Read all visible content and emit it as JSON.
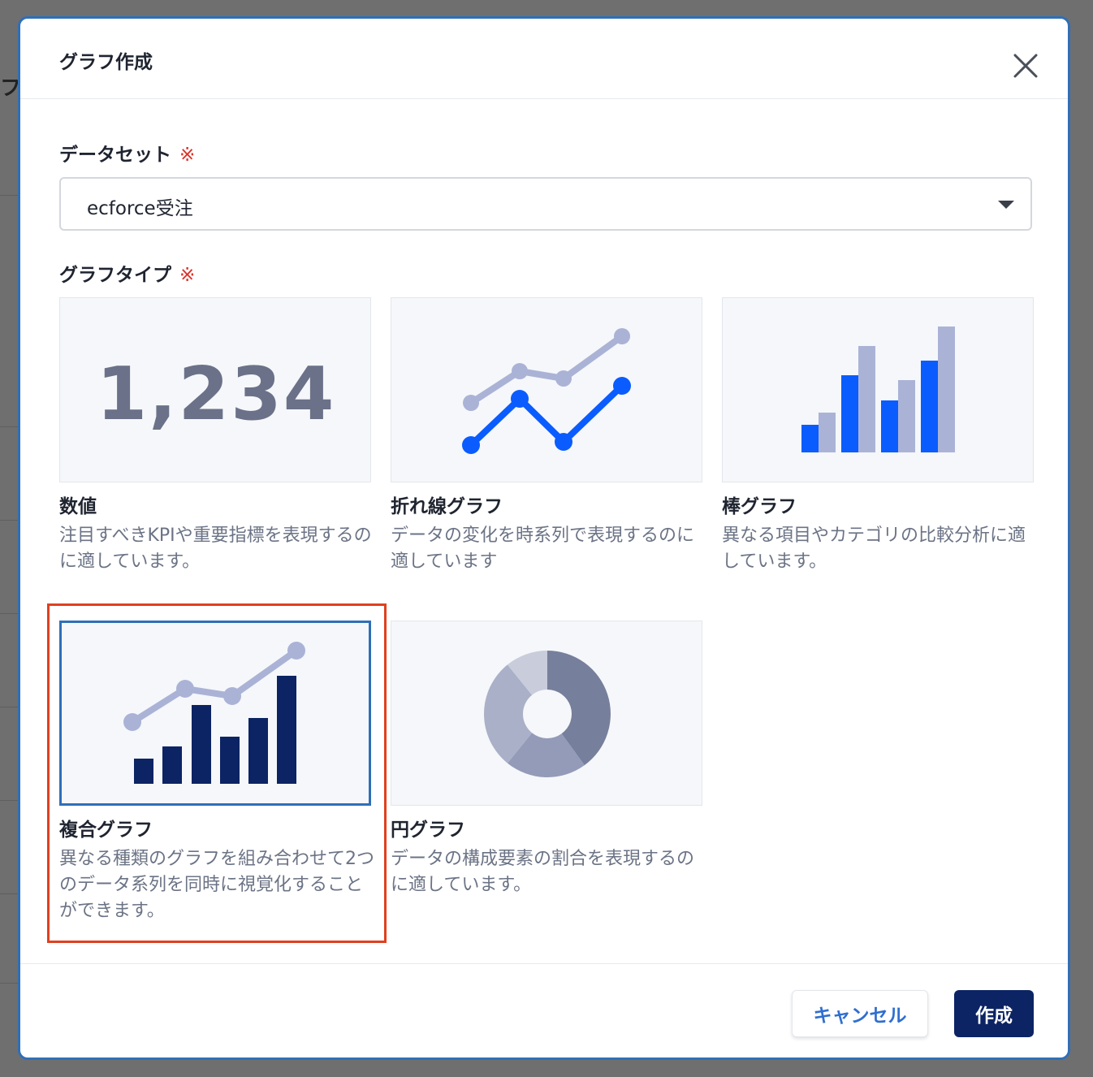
{
  "modal": {
    "title": "グラフ作成",
    "close_icon": "close-icon"
  },
  "dataset": {
    "label": "データセット",
    "required_mark": "※",
    "selected_value": "ecforce受注",
    "caret_icon": "caret-down-icon"
  },
  "graph_type": {
    "label": "グラフタイプ",
    "required_mark": "※",
    "selected": "複合グラフ",
    "options": [
      {
        "title": "数値",
        "description": "注目すべきKPIや重要指標を表現するのに適しています。",
        "preview_text": "1,234",
        "icon": "kpi-number-preview"
      },
      {
        "title": "折れ線グラフ",
        "description": "データの変化を時系列で表現するのに適しています",
        "icon": "line-chart-preview"
      },
      {
        "title": "棒グラフ",
        "description": "異なる項目やカテゴリの比較分析に適しています。",
        "icon": "bar-chart-preview"
      },
      {
        "title": "複合グラフ",
        "description": "異なる種類のグラフを組み合わせて2つのデータ系列を同時に視覚化することができます。",
        "icon": "combo-chart-preview"
      },
      {
        "title": "円グラフ",
        "description": "データの構成要素の割合を表現するのに適しています。",
        "icon": "donut-chart-preview"
      }
    ]
  },
  "footer": {
    "cancel_label": "キャンセル",
    "create_label": "作成"
  },
  "colors": {
    "accent_blue": "#0a5cff",
    "light_series": "#aab3d6",
    "navy": "#0c2464",
    "selection_border": "#2f6fb8",
    "highlight_border": "#e0401f",
    "required": "#d9342b"
  }
}
